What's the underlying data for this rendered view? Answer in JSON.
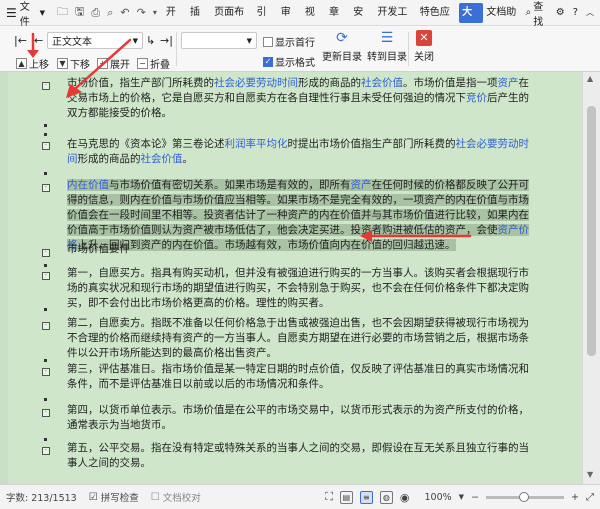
{
  "menubar": {
    "file_label": "文件",
    "menu_items": [
      "开始",
      "插入",
      "页面布局",
      "引用",
      "审阅",
      "视图",
      "章节",
      "安全",
      "开发工具",
      "特色应用",
      "大纲",
      "文档助手"
    ],
    "active_index": 10,
    "search_label": "查找"
  },
  "ribbon": {
    "style_select": "正文文本",
    "move_up": "上移",
    "move_down": "下移",
    "expand": "展开",
    "collapse": "折叠",
    "show_first_line": "显示首行",
    "show_format": "显示格式",
    "update_toc": "更新目录",
    "goto_toc": "转到目录",
    "close": "关闭"
  },
  "document": {
    "p1_a": "市场价值，指生产部门所耗费的",
    "p1_link1": "社会必要劳动时间",
    "p1_b": "形成的商品的",
    "p1_link2": "社会价值",
    "p1_c": "。市场价值是指一项",
    "p1_link3": "资产",
    "p1_d": "在交易市场上的价格，它是自愿买方和自愿卖方在各自理性行事且未受任何强迫的情况下",
    "p1_link4": "竞价",
    "p1_e": "后产生的双方都能接受的价格。",
    "p2_a": "在马克思的《资本论》第三卷论述",
    "p2_link1": "利润率平均化",
    "p2_b": "时提出市场价值指生产部门所耗费的",
    "p2_link2": "社会必要劳动时间",
    "p2_c": "形成的商品的",
    "p2_link3": "社会价值",
    "p2_d": "。",
    "p3_link1": "内在价值",
    "p3_a": "与市场价值有密切关系。如果市场是有效的，即所有",
    "p3_link2": "资产",
    "p3_b": "在任何时候的价格都反映了公开可得的信息，则内在价值与市场价值应当相等。如果市场不是完全有效的，一项资产的内在价值与市场价值会在一段时间里不相等。投资者估计了一种资产的内在价值并与其市场价值进行比较，如果内在价值高于市场价值则认为资产被市场低估了，他会决定买进。投资者购进被低估的资产，会使",
    "p3_link3": "资产价格",
    "p3_c": "上升，回归到资产的内在价值。市场越有效，市场价值向内在价值的回归越迅速。",
    "p4": "市场价值要件",
    "p5": "第一，自愿买方。指具有购买动机，但并没有被强迫进行购买的一方当事人。该购买者会根据现行市场的真实状况和现行市场的期望值进行购买，不会特别急于购买，也不会在任何价格条件下都决定购买，即不会付出比市场价格更高的价格。理性的购买者。",
    "p6": "第二，自愿卖方。指既不准备以任何价格急于出售或被强迫出售，也不会因期望获得被现行市场视为不合理的价格而继续持有资产的一方当事人。自愿卖方期望在进行必要的市场营销之后，根据市场条件以公开市场所能达到的最高价格出售资产。",
    "p7": "第三，评估基准日。指市场价值是某一特定日期的时点价值，仅反映了评估基准日的真实市场情况和条件，而不是评估基准日以前或以后的市场情况和条件。",
    "p8": "第四，以货币单位表示。市场价值是在公平的市场交易中，以货币形式表示的为资产所支付的价格，通常表示为当地货币。",
    "p9": "第五，公平交易。指在没有特定或特殊关系的当事人之间的交易，即假设在互无关系且独立行事的当事人之间的交易。"
  },
  "status": {
    "word_count": "字数: 213/1513",
    "spell_check": "拼写检查",
    "doc_check": "文档校对",
    "zoom": "100%"
  },
  "colors": {
    "accent": "#3a6fd8",
    "doc_bg": "#cfe6cb",
    "link": "#2e5fd4",
    "highlight": "#a9c2a4",
    "annotation": "#e53935"
  }
}
